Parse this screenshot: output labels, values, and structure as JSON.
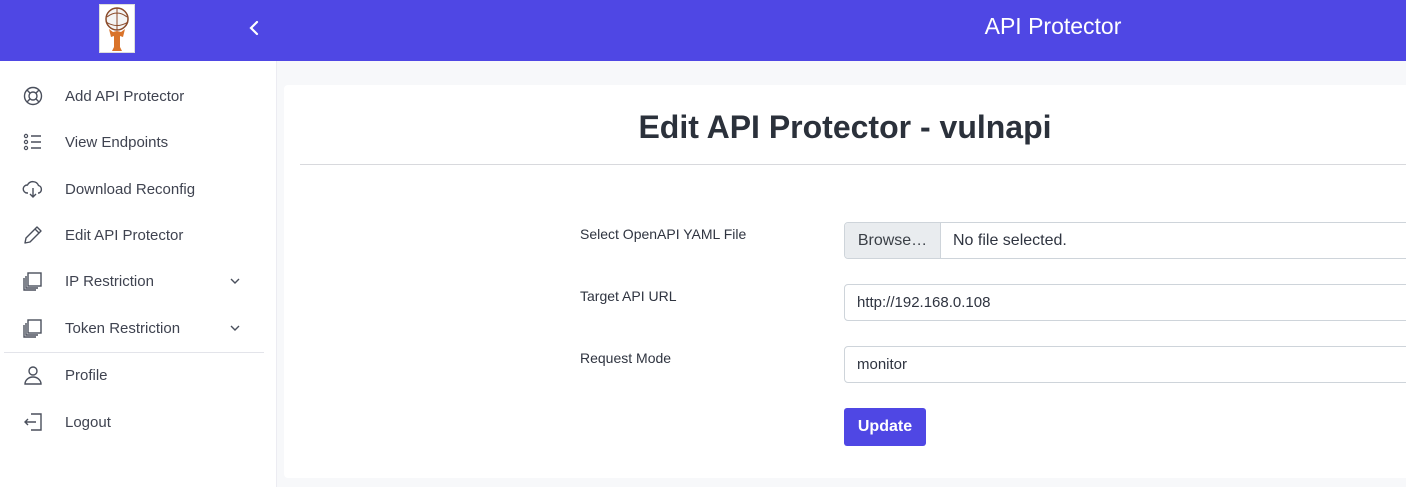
{
  "app": {
    "title": "API Protector"
  },
  "sidebar": {
    "items": [
      {
        "label": "Add API Protector",
        "icon": "lifebuoy-icon"
      },
      {
        "label": "View Endpoints",
        "icon": "list-icon"
      },
      {
        "label": "Download Reconfig",
        "icon": "cloud-download-icon"
      },
      {
        "label": "Edit API Protector",
        "icon": "pencil-icon"
      },
      {
        "label": "IP Restriction",
        "icon": "stack-icon",
        "expandable": true
      },
      {
        "label": "Token Restriction",
        "icon": "stack-icon",
        "expandable": true
      },
      {
        "label": "Profile",
        "icon": "user-icon"
      },
      {
        "label": "Logout",
        "icon": "logout-icon"
      }
    ]
  },
  "main": {
    "title": "Edit API Protector - vulnapi",
    "form": {
      "file_label": "Select OpenAPI YAML File",
      "file_button": "Browse…",
      "file_status": "No file selected.",
      "url_label": "Target API URL",
      "url_value": "http://192.168.0.108",
      "mode_label": "Request Mode",
      "mode_value": "monitor",
      "submit_label": "Update"
    }
  },
  "colors": {
    "accent": "#4f47e4",
    "header_text": "#ffffff"
  }
}
